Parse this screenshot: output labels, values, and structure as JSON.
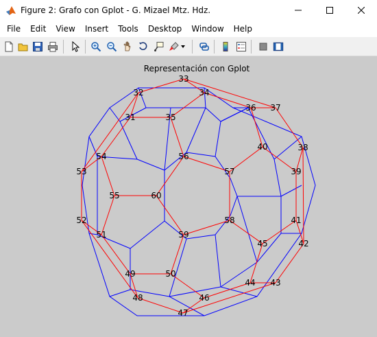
{
  "window": {
    "title": "Figure 2: Grafo con Gplot - G. Mizael Mtz. Hdz."
  },
  "menu": {
    "items": [
      "File",
      "Edit",
      "View",
      "Insert",
      "Tools",
      "Desktop",
      "Window",
      "Help"
    ]
  },
  "toolbar": {
    "icons": [
      "new-figure-icon",
      "open-file-icon",
      "save-icon",
      "print-icon",
      "edit-plot-icon",
      "zoom-in-icon",
      "zoom-out-icon",
      "pan-icon",
      "rotate-3d-icon",
      "data-cursor-icon",
      "brush-icon",
      "link-plot-icon",
      "colorbar-icon",
      "legend-icon",
      "hide-plot-tools-icon",
      "show-plot-tools-icon"
    ]
  },
  "plot": {
    "title": "Representación con Gplot",
    "colors": {
      "background": "#cbcbcb",
      "blue_edges": "#0000ff",
      "red_edges": "#ff0000"
    }
  },
  "chart_data": {
    "type": "graph",
    "title": "Representación con Gplot",
    "labeled_nodes": [
      "31",
      "32",
      "33",
      "34",
      "35",
      "36",
      "37",
      "38",
      "39",
      "40",
      "41",
      "42",
      "43",
      "44",
      "45",
      "46",
      "47",
      "48",
      "49",
      "50",
      "51",
      "52",
      "53",
      "54",
      "55",
      "56",
      "57",
      "58",
      "59",
      "60"
    ],
    "red_cycles": [
      [
        "31",
        "32",
        "33",
        "34",
        "35"
      ],
      [
        "36",
        "37",
        "38",
        "39",
        "40"
      ],
      [
        "41",
        "42",
        "43",
        "44",
        "45"
      ],
      [
        "46",
        "47",
        "48",
        "49",
        "50"
      ],
      [
        "51",
        "52",
        "53",
        "54",
        "55"
      ],
      [
        "56",
        "57",
        "58",
        "59",
        "60"
      ]
    ],
    "red_links": [
      [
        "33",
        "37"
      ],
      [
        "38",
        "42"
      ],
      [
        "43",
        "47"
      ],
      [
        "48",
        "52"
      ],
      [
        "53",
        "32"
      ],
      [
        "35",
        "56"
      ],
      [
        "40",
        "57"
      ],
      [
        "45",
        "58"
      ],
      [
        "50",
        "59"
      ],
      [
        "55",
        "60"
      ],
      [
        "34",
        "36"
      ],
      [
        "39",
        "41"
      ],
      [
        "44",
        "46"
      ],
      [
        "49",
        "51"
      ],
      [
        "54",
        "31"
      ]
    ]
  }
}
